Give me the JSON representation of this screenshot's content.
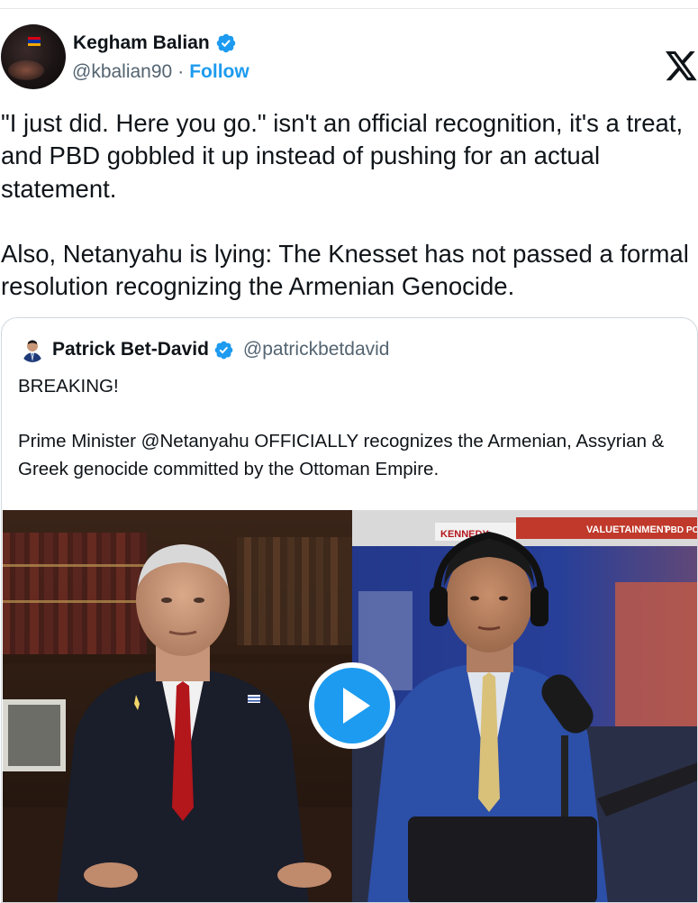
{
  "author": {
    "display_name": "Kegham Balian",
    "handle": "@kbalian90",
    "separator": "·",
    "follow_label": "Follow"
  },
  "tweet": {
    "paragraph_1": "\"I just did. Here you go.\" isn't an official recognition, it's a treat, and PBD gobbled it up instead of pushing for an actual statement.",
    "paragraph_2": "Also, Netanyahu is lying: The Knesset has not passed a formal resolution recognizing the Armenian Genocide."
  },
  "quoted": {
    "display_name": "Patrick Bet-David",
    "handle": "@patrickbetdavid",
    "line_1": "BREAKING!",
    "line_2": "Prime Minister @Netanyahu OFFICIALLY recognizes the Armenian, Assyrian & Greek genocide committed by the Ottoman Empire.",
    "media": {
      "type": "video",
      "overlay_text_1": "KENNEDY",
      "overlay_text_2": "VALUETAINMENT",
      "overlay_text_3": "PBD POD"
    }
  },
  "colors": {
    "accent": "#1d9bf0",
    "text": "#0f1419",
    "secondary": "#536471",
    "border": "#cfd9de"
  },
  "icons": {
    "verified": "verified-badge-icon",
    "x_logo": "x-logo-icon",
    "play": "play-icon"
  }
}
